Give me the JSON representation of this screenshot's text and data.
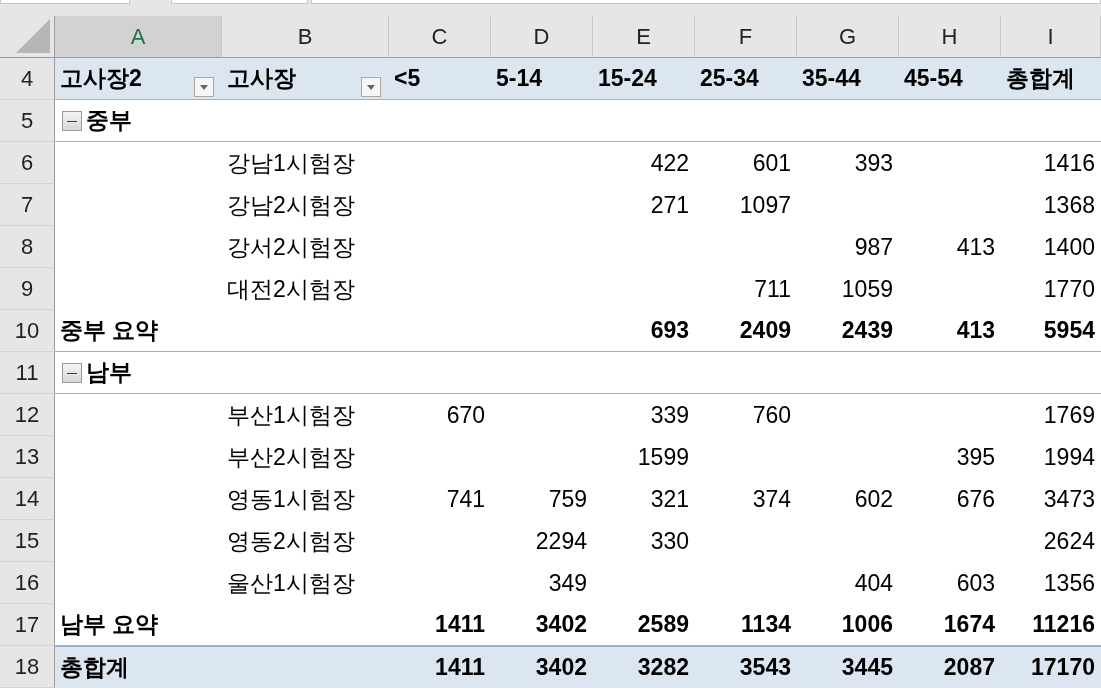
{
  "columns": [
    {
      "label": "A",
      "selected": true
    },
    {
      "label": "B",
      "selected": false
    },
    {
      "label": "C",
      "selected": false
    },
    {
      "label": "D",
      "selected": false
    },
    {
      "label": "E",
      "selected": false
    },
    {
      "label": "F",
      "selected": false
    },
    {
      "label": "G",
      "selected": false
    },
    {
      "label": "H",
      "selected": false
    },
    {
      "label": "I",
      "selected": false
    }
  ],
  "rows": [
    {
      "number": "4",
      "kind": "header",
      "cells": [
        {
          "text": "고사장2",
          "filter": true
        },
        {
          "text": "고사장",
          "filter": true
        },
        {
          "text": "<5"
        },
        {
          "text": "5-14"
        },
        {
          "text": "15-24"
        },
        {
          "text": "25-34"
        },
        {
          "text": "35-44"
        },
        {
          "text": "45-54"
        },
        {
          "text": "총합계"
        }
      ]
    },
    {
      "number": "5",
      "kind": "group",
      "label": "중부",
      "expanded": true
    },
    {
      "number": "6",
      "kind": "item",
      "cells": [
        null,
        "강남1시험장",
        null,
        null,
        "422",
        "601",
        "393",
        null,
        "1416"
      ]
    },
    {
      "number": "7",
      "kind": "item",
      "cells": [
        null,
        "강남2시험장",
        null,
        null,
        "271",
        "1097",
        null,
        null,
        "1368"
      ]
    },
    {
      "number": "8",
      "kind": "item",
      "cells": [
        null,
        "강서2시험장",
        null,
        null,
        null,
        null,
        "987",
        "413",
        "1400"
      ]
    },
    {
      "number": "9",
      "kind": "item",
      "cells": [
        null,
        "대전2시험장",
        null,
        null,
        null,
        "711",
        "1059",
        null,
        "1770"
      ]
    },
    {
      "number": "10",
      "kind": "subtotal",
      "cells": [
        "중부 요약",
        null,
        null,
        null,
        "693",
        "2409",
        "2439",
        "413",
        "5954"
      ]
    },
    {
      "number": "11",
      "kind": "group",
      "label": "남부",
      "expanded": true
    },
    {
      "number": "12",
      "kind": "item",
      "cells": [
        null,
        "부산1시험장",
        "670",
        null,
        "339",
        "760",
        null,
        null,
        "1769"
      ]
    },
    {
      "number": "13",
      "kind": "item",
      "cells": [
        null,
        "부산2시험장",
        null,
        null,
        "1599",
        null,
        null,
        "395",
        "1994"
      ]
    },
    {
      "number": "14",
      "kind": "item",
      "cells": [
        null,
        "영동1시험장",
        "741",
        "759",
        "321",
        "374",
        "602",
        "676",
        "3473"
      ]
    },
    {
      "number": "15",
      "kind": "item",
      "cells": [
        null,
        "영동2시험장",
        null,
        "2294",
        "330",
        null,
        null,
        null,
        "2624"
      ]
    },
    {
      "number": "16",
      "kind": "item",
      "cells": [
        null,
        "울산1시험장",
        null,
        "349",
        null,
        null,
        "404",
        "603",
        "1356"
      ]
    },
    {
      "number": "17",
      "kind": "subtotal",
      "cells": [
        "남부 요약",
        null,
        "1411",
        "3402",
        "2589",
        "1134",
        "1006",
        "1674",
        "11216"
      ]
    },
    {
      "number": "18",
      "kind": "grand",
      "cells": [
        "총합계",
        null,
        "1411",
        "3402",
        "3282",
        "3543",
        "3445",
        "2087",
        "17170"
      ]
    }
  ]
}
